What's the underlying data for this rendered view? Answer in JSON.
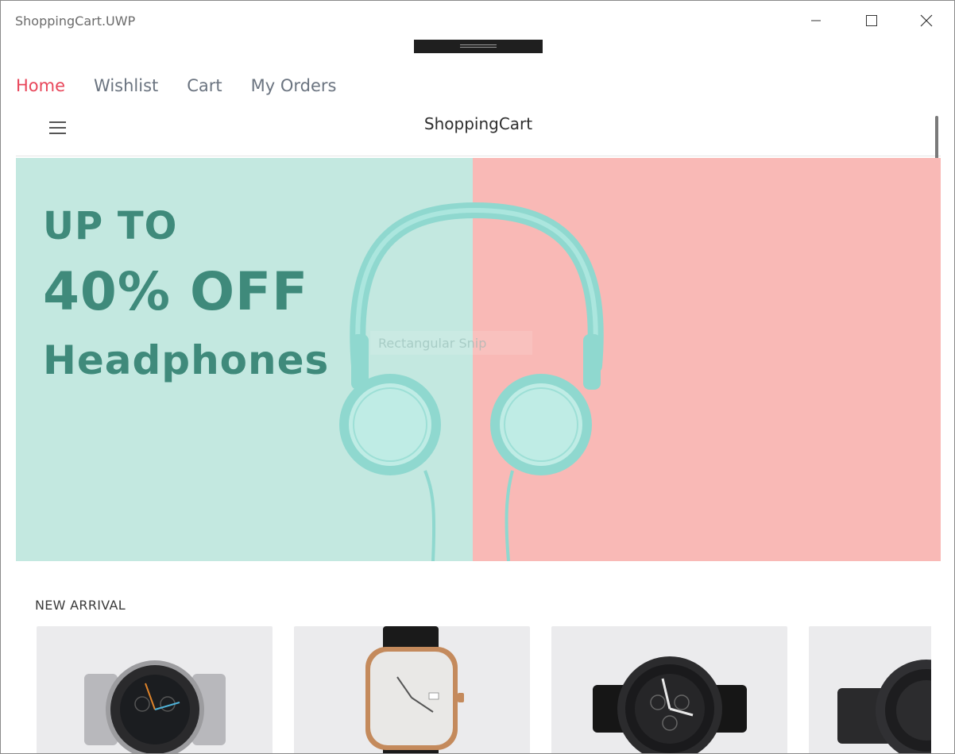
{
  "window": {
    "title": "ShoppingCart.UWP",
    "caption_buttons": [
      "minimize-icon",
      "maximize-icon",
      "close-icon"
    ]
  },
  "nav": {
    "tabs": [
      {
        "label": "Home",
        "active": true
      },
      {
        "label": "Wishlist",
        "active": false
      },
      {
        "label": "Cart",
        "active": false
      },
      {
        "label": "My Orders",
        "active": false
      }
    ]
  },
  "header": {
    "menu_icon": "hamburger-menu-icon",
    "title": "ShoppingCart"
  },
  "banner": {
    "line1": "UP TO",
    "line2": "40% OFF",
    "line3": "Headphones",
    "overlay_text": "Rectangular Snip",
    "colors": {
      "left": "#c3e8e0",
      "right": "#f9b9b6",
      "text": "#3f8a7b",
      "headphones": "#8fd8cf"
    }
  },
  "new_arrival": {
    "title": "NEW ARRIVAL",
    "products": [
      {
        "image": "silver-chronograph-watch"
      },
      {
        "image": "rose-gold-leather-watch"
      },
      {
        "image": "black-nato-strap-watch"
      },
      {
        "image": "black-steel-watch"
      }
    ]
  },
  "colors": {
    "accent": "#e8465a",
    "tab_text": "#6b7480"
  }
}
